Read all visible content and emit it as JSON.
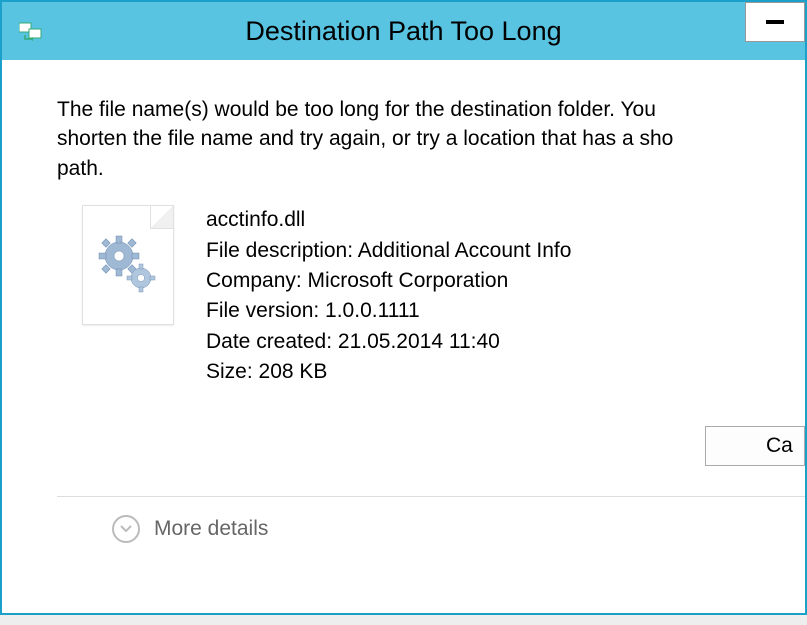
{
  "title": "Destination Path Too Long",
  "message_line1": "The file name(s) would be too long for the destination folder. You",
  "message_line2": "shorten the file name and try again, or try a location that has a sho",
  "message_line3": "path.",
  "file": {
    "name": "acctinfo.dll",
    "description_label": "File description: ",
    "description_value": "Additional Account Info",
    "company_label": "Company: ",
    "company_value": "Microsoft Corporation",
    "version_label": "File version: ",
    "version_value": "1.0.0.1111",
    "date_label": "Date created: ",
    "date_value": "21.05.2014 11:40",
    "size_label": "Size: ",
    "size_value": "208 KB"
  },
  "buttons": {
    "cancel": "Ca"
  },
  "footer": {
    "more_details": "More details"
  }
}
